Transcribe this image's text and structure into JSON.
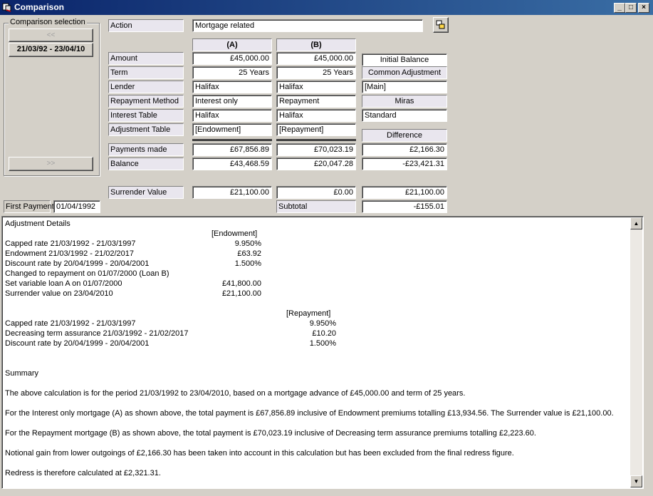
{
  "window": {
    "title": "Comparison",
    "controls": [
      "_",
      "□",
      "×"
    ]
  },
  "comparison_selection": {
    "label": "Comparison selection",
    "prev_button": "<<",
    "period_button": "21/03/92 - 23/04/10",
    "next_button": ">>"
  },
  "action": {
    "label": "Action",
    "value": "Mortgage related"
  },
  "columns": {
    "a": "(A)",
    "b": "(B)"
  },
  "rows": [
    {
      "label": "Amount",
      "a": "£45,000.00",
      "b": "£45,000.00"
    },
    {
      "label": "Term",
      "a": "25 Years",
      "b": "25 Years"
    },
    {
      "label": "Lender",
      "a": "Halifax",
      "b": "Halifax"
    },
    {
      "label": "Repayment Method",
      "a": "Interest only",
      "b": "Repayment"
    },
    {
      "label": "Interest Table",
      "a": "Halifax",
      "b": "Halifax"
    },
    {
      "label": "Adjustment Table",
      "a": "[Endowment]",
      "b": "[Repayment]"
    }
  ],
  "right_panel": {
    "initial_balance": "Initial Balance",
    "common_adjustment": "Common Adjustment",
    "adjustment_value": "[Main]",
    "miras": "Miras",
    "miras_value": "Standard",
    "difference": "Difference"
  },
  "results": [
    {
      "label": "Payments made",
      "a": "£67,856.89",
      "b": "£70,023.19",
      "diff": "£2,166.30"
    },
    {
      "label": "Balance",
      "a": "£43,468.59",
      "b": "£20,047.28",
      "diff": "-£23,421.31"
    }
  ],
  "surrender": {
    "label": "Surrender Value",
    "a": "£21,100.00",
    "b": "£0.00",
    "diff": "£21,100.00"
  },
  "first_payment": {
    "label": "First Payment",
    "value": "01/04/1992"
  },
  "subtotal": {
    "label": "Subtotal",
    "value": "-£155.01"
  },
  "details": {
    "heading": "Adjustment Details",
    "endowment_header": "[Endowment]",
    "endowment_lines": [
      {
        "desc": "Capped rate 21/03/1992 - 21/03/1997",
        "value": "9.950%"
      },
      {
        "desc": "Endowment 21/03/1992 - 21/02/2017",
        "value": "£63.92"
      },
      {
        "desc": "Discount rate by 20/04/1999 - 20/04/2001",
        "value": "1.500%"
      },
      {
        "desc": "Changed to repayment on 01/07/2000  (Loan B)",
        "value": ""
      },
      {
        "desc": "Set variable loan A on 01/07/2000",
        "value": "£41,800.00"
      },
      {
        "desc": "Surrender value on 23/04/2010",
        "value": "£21,100.00"
      }
    ],
    "repayment_header": "[Repayment]",
    "repayment_lines": [
      {
        "desc": "Capped rate 21/03/1992 - 21/03/1997",
        "value": "9.950%"
      },
      {
        "desc": "Decreasing term assurance 21/03/1992 - 21/02/2017",
        "value": "£10.20"
      },
      {
        "desc": "Discount rate by 20/04/1999 - 20/04/2001",
        "value": "1.500%"
      }
    ],
    "summary_heading": "Summary",
    "summary_lines": [
      "The above calculation is for the period 21/03/1992 to 23/04/2010, based on a mortgage advance of £45,000.00 and term of 25 years.",
      "For the Interest only mortgage (A) as shown above, the total payment is £67,856.89 inclusive of Endowment premiums totalling £13,934.56. The Surrender value is £21,100.00.",
      "For the Repayment mortgage (B) as shown above, the total payment is £70,023.19 inclusive of Decreasing term assurance premiums totalling £2,223.60.",
      "Notional gain from lower outgoings of £2,166.30 has been taken into account in this calculation but has been excluded from the final redress figure.",
      "Redress is therefore calculated at £2,321.31."
    ]
  },
  "scrollbar": {
    "up": "▲",
    "down": "▼"
  }
}
